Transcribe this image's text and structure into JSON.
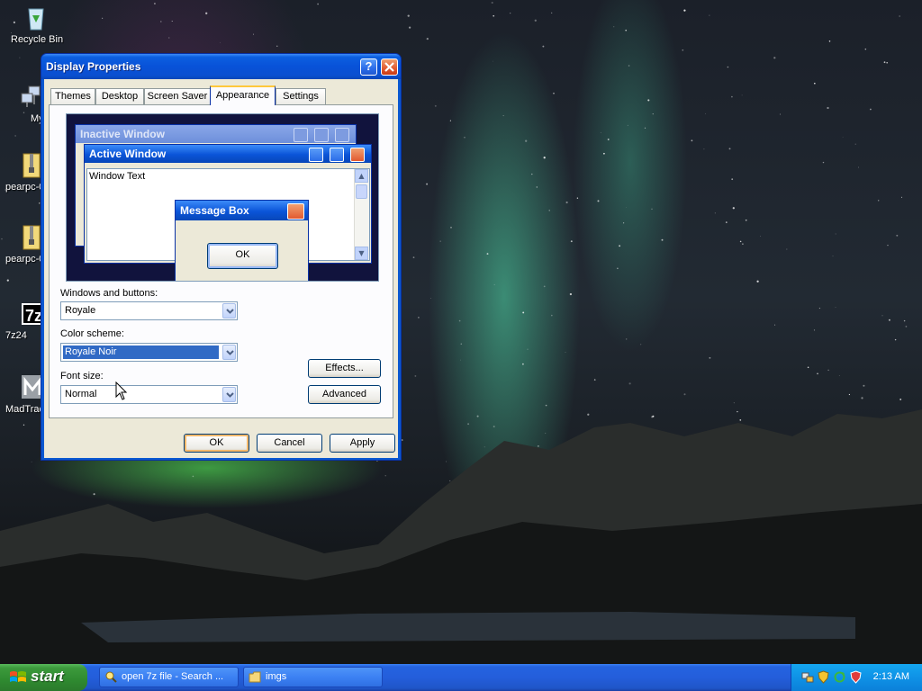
{
  "desktop": {
    "icons": [
      {
        "label": "Recycle Bin",
        "icon": "recycle-bin-icon"
      },
      {
        "label": "MyP",
        "icon": "network-icon"
      },
      {
        "label": "pearpc-0",
        "icon": "zip-folder-icon"
      },
      {
        "label": "pearpc-0",
        "icon": "zip-folder-icon"
      },
      {
        "label": "7z24",
        "icon": "7zip-icon"
      },
      {
        "label": "MadTrac",
        "icon": "madtracker-icon"
      }
    ]
  },
  "dialog": {
    "title": "Display Properties",
    "help_label": "?",
    "tabs": [
      {
        "label": "Themes"
      },
      {
        "label": "Desktop"
      },
      {
        "label": "Screen Saver"
      },
      {
        "label": "Appearance",
        "active": true
      },
      {
        "label": "Settings"
      }
    ],
    "preview": {
      "inactive_title": "Inactive Window",
      "active_title": "Active Window",
      "window_text": "Window Text",
      "message_title": "Message Box",
      "message_ok": "OK"
    },
    "windows_buttons_label": "Windows and buttons:",
    "windows_buttons_value": "Royale",
    "color_scheme_label": "Color scheme:",
    "color_scheme_value": "Royale Noir",
    "font_size_label": "Font size:",
    "font_size_value": "Normal",
    "effects_label": "Effects...",
    "advanced_label": "Advanced",
    "ok_label": "OK",
    "cancel_label": "Cancel",
    "apply_label": "Apply"
  },
  "taskbar": {
    "start_label": "start",
    "items": [
      {
        "label": "open 7z file - Search ...",
        "icon": "search-icon"
      },
      {
        "label": "imgs",
        "icon": "folder-icon"
      }
    ],
    "clock": "2:13 AM"
  },
  "colors": {
    "title_blue": "#0a54d8",
    "start_green": "#3c9a3c",
    "tray_blue": "#0f92e6",
    "selection_blue": "#316ac5"
  }
}
